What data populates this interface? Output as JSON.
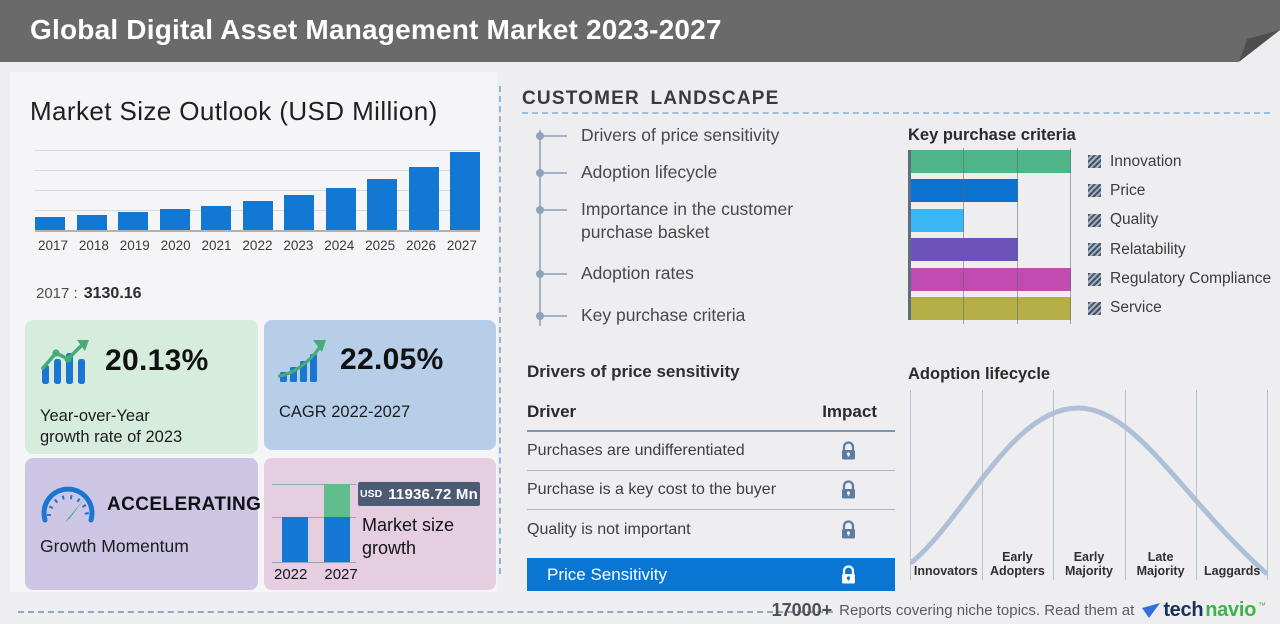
{
  "header": {
    "title": "Global Digital Asset Management Market 2023-2027"
  },
  "left_panel": {
    "chart_title": "Market Size Outlook (USD Million)",
    "years": [
      "2017",
      "2018",
      "2019",
      "2020",
      "2021",
      "2022",
      "2023",
      "2024",
      "2025",
      "2026",
      "2027"
    ],
    "base_year_label": "2017 :",
    "base_year_value": "3130.16",
    "stats": {
      "yoy": {
        "value": "20.13%",
        "label": "Year-over-Year\ngrowth rate of 2023"
      },
      "cagr": {
        "value": "22.05%",
        "label": "CAGR 2022-2027"
      },
      "momentum": {
        "value": "ACCELERATING",
        "label": "Growth Momentum"
      },
      "growth": {
        "currency": "USD",
        "amount": "11936.72 Mn",
        "label": "Market size\ngrowth",
        "year_start": "2022",
        "year_end": "2027"
      }
    }
  },
  "customer_landscape": {
    "title": "CUSTOMER LANDSCAPE",
    "items": [
      "Drivers of price sensitivity",
      "Adoption lifecycle",
      "Importance in the customer purchase basket",
      "Adoption rates",
      "Key purchase criteria"
    ],
    "drivers": {
      "title": "Drivers of price sensitivity",
      "col_driver": "Driver",
      "col_impact": "Impact",
      "rows": [
        "Purchases are undifferentiated",
        "Purchase is a key cost to the buyer",
        "Quality is not important"
      ],
      "highlight": "Price Sensitivity"
    },
    "purchase_criteria": {
      "title": "Key purchase criteria",
      "legend": [
        "Innovation",
        "Price",
        "Quality",
        "Relatability",
        "Regulatory Compliance",
        "Service"
      ]
    },
    "lifecycle": {
      "title": "Adoption lifecycle",
      "stages": [
        "Innovators",
        "Early Adopters",
        "Early Majority",
        "Late Majority",
        "Laggards"
      ]
    }
  },
  "footer": {
    "count": "17000+",
    "text": "Reports covering niche topics. Read them at",
    "brand_tech": "tech",
    "brand_navio": "navio",
    "brand_tm": "™"
  },
  "colors": {
    "header_bg": "#6a6a6a",
    "bar_blue": "#1278d3",
    "growth_green": "#62bd8e",
    "highlight_row": "#0a76d4",
    "badge_bg": "#4c5b73",
    "box_green": "#d6ecdc",
    "box_blue": "#b7cee9",
    "box_purple": "#cdc7e5",
    "box_pink": "#e4cee0",
    "curve": "#aebfd6",
    "criteria_colors": [
      "#4fb589",
      "#0b73cf",
      "#38b7f4",
      "#6d52ba",
      "#c04cb2",
      "#b6ae47"
    ]
  },
  "chart_data": [
    {
      "type": "bar",
      "title": "Market Size Outlook (USD Million)",
      "categories": [
        "2017",
        "2018",
        "2019",
        "2020",
        "2021",
        "2022",
        "2023",
        "2024",
        "2025",
        "2026",
        "2027"
      ],
      "values": [
        3130.16,
        3675,
        4315,
        5067,
        5950,
        6986,
        8392,
        10196,
        12490,
        15363,
        18921
      ],
      "note": "Only 2017 value (3130.16) labeled; later values estimated from bar heights, YoY 20.13% (2023), CAGR 22.05% (2022-2027), increment USD 11936.72 Mn (2022-2027)",
      "xlabel": "",
      "ylabel": "",
      "ylim": [
        0,
        20000
      ],
      "grid": true
    },
    {
      "type": "bar",
      "orientation": "horizontal",
      "title": "Key purchase criteria",
      "categories": [
        "Innovation",
        "Price",
        "Quality",
        "Relatability",
        "Regulatory Compliance",
        "Service"
      ],
      "values": [
        3,
        2,
        1,
        2,
        3,
        3
      ],
      "xlim": [
        0,
        3
      ],
      "note": "values in grid units estimated from gridlines",
      "legend_position": "right",
      "colors": [
        "#4fb589",
        "#0b73cf",
        "#38b7f4",
        "#6d52ba",
        "#c04cb2",
        "#b6ae47"
      ]
    },
    {
      "type": "line",
      "title": "Adoption lifecycle",
      "categories": [
        "Innovators",
        "Early Adopters",
        "Early Majority",
        "Late Majority",
        "Laggards"
      ],
      "shape": "bell curve, peak within Early Majority",
      "grid": true
    },
    {
      "type": "bar",
      "title": "Market size growth",
      "categories": [
        "2022",
        "2027"
      ],
      "series": [
        {
          "name": "base market size",
          "values": [
            6986,
            6986
          ]
        },
        {
          "name": "incremental growth",
          "values": [
            0,
            11936.72
          ]
        }
      ],
      "annotation": "USD 11936.72 Mn"
    }
  ]
}
